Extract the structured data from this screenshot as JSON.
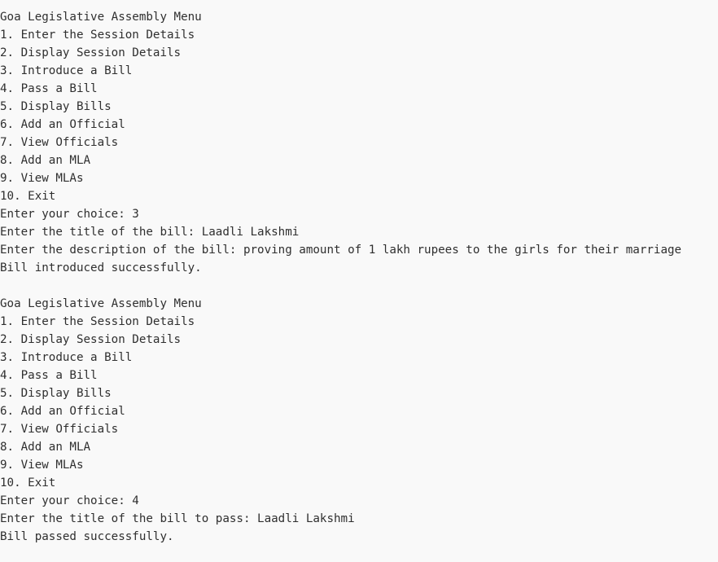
{
  "console": {
    "blocks": [
      {
        "lines": [
          "Goa Legislative Assembly Menu",
          "1. Enter the Session Details",
          "2. Display Session Details",
          "3. Introduce a Bill",
          "4. Pass a Bill",
          "5. Display Bills",
          "6. Add an Official",
          "7. View Officials",
          "8. Add an MLA",
          "9. View MLAs",
          "10. Exit",
          "Enter your choice: 3",
          "Enter the title of the bill: Laadli Lakshmi",
          "Enter the description of the bill: proving amount of 1 lakh rupees to the girls for their marriage",
          "Bill introduced successfully."
        ]
      },
      {
        "lines": [
          "Goa Legislative Assembly Menu",
          "1. Enter the Session Details",
          "2. Display Session Details",
          "3. Introduce a Bill",
          "4. Pass a Bill",
          "5. Display Bills",
          "6. Add an Official",
          "7. View Officials",
          "8. Add an MLA",
          "9. View MLAs",
          "10. Exit",
          "Enter your choice: 4",
          "Enter the title of the bill to pass: Laadli Lakshmi",
          "Bill passed successfully."
        ]
      }
    ]
  }
}
